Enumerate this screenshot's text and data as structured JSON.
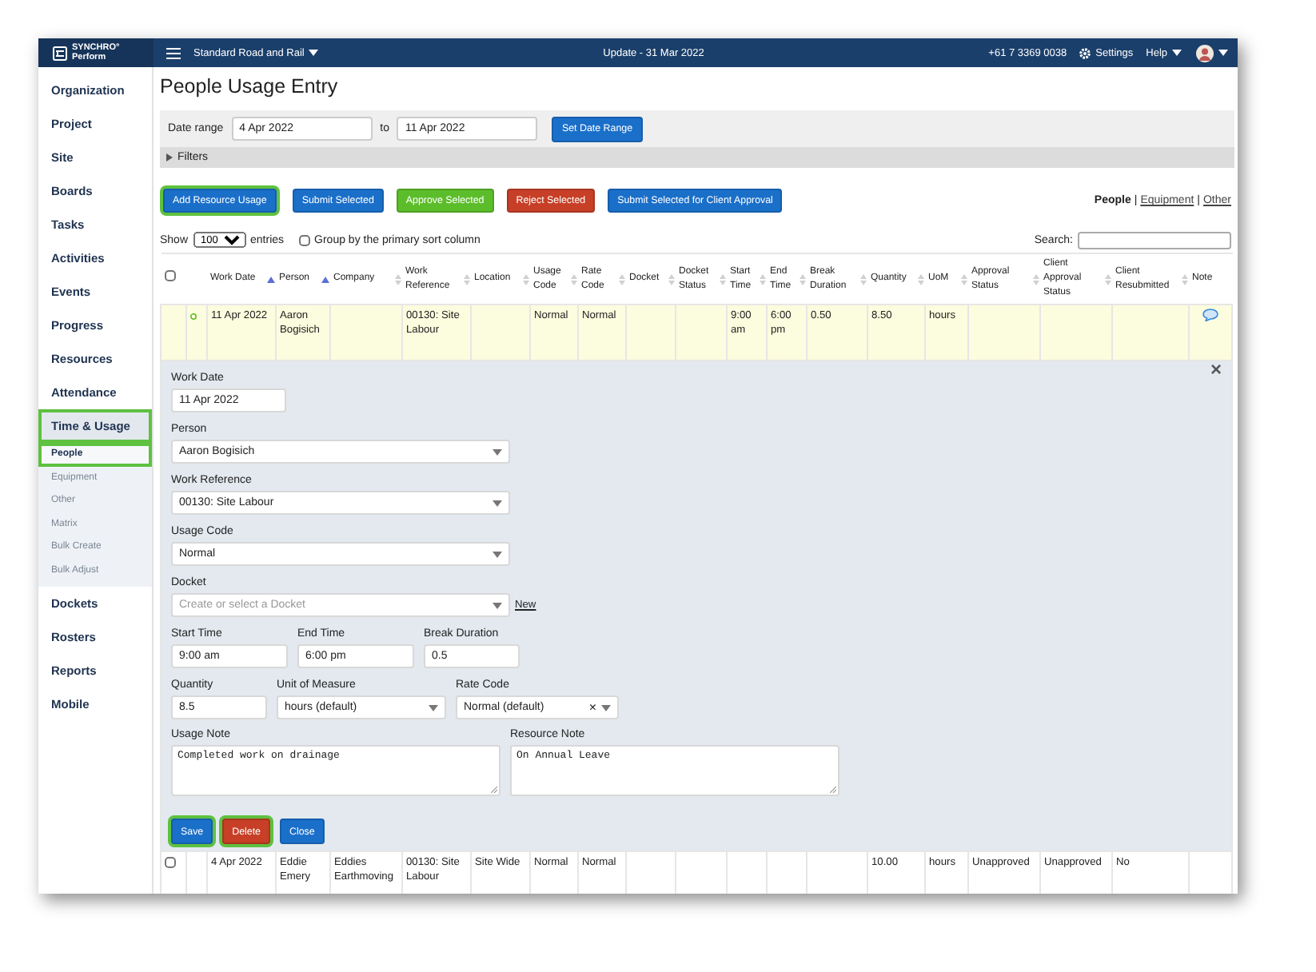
{
  "topbar": {
    "logo_line1": "SYNCHRO",
    "logo_mark": "°",
    "logo_line2": "Perform",
    "project": "Standard Road and Rail",
    "update": "Update - 31 Mar 2022",
    "phone": "+61 7 3369 0038",
    "settings": "Settings",
    "help": "Help"
  },
  "sidebar": {
    "items": [
      {
        "label": "Organization",
        "selected": false,
        "highlighted": false
      },
      {
        "label": "Project",
        "selected": false,
        "highlighted": false
      },
      {
        "label": "Site",
        "selected": false,
        "highlighted": false
      },
      {
        "label": "Boards",
        "selected": false,
        "highlighted": false
      },
      {
        "label": "Tasks",
        "selected": false,
        "highlighted": false
      },
      {
        "label": "Activities",
        "selected": false,
        "highlighted": false
      },
      {
        "label": "Events",
        "selected": false,
        "highlighted": false
      },
      {
        "label": "Progress",
        "selected": false,
        "highlighted": false
      },
      {
        "label": "Resources",
        "selected": false,
        "highlighted": false
      },
      {
        "label": "Attendance",
        "selected": false,
        "highlighted": false
      },
      {
        "label": "Time & Usage",
        "selected": true,
        "highlighted": true,
        "children": [
          {
            "label": "People",
            "selected": true,
            "highlighted": true
          },
          {
            "label": "Equipment",
            "selected": false,
            "highlighted": false
          },
          {
            "label": "Other",
            "selected": false,
            "highlighted": false
          },
          {
            "label": "Matrix",
            "selected": false,
            "highlighted": false
          },
          {
            "label": "Bulk Create",
            "selected": false,
            "highlighted": false
          },
          {
            "label": "Bulk Adjust",
            "selected": false,
            "highlighted": false
          }
        ]
      },
      {
        "label": "Dockets",
        "selected": false,
        "highlighted": false
      },
      {
        "label": "Rosters",
        "selected": false,
        "highlighted": false
      },
      {
        "label": "Reports",
        "selected": false,
        "highlighted": false
      },
      {
        "label": "Mobile",
        "selected": false,
        "highlighted": false
      }
    ]
  },
  "page_title": "People Usage Entry",
  "date_range": {
    "label": "Date range",
    "from": "4 Apr 2022",
    "to_label": "to",
    "to": "11 Apr 2022",
    "button": "Set Date Range"
  },
  "filters": {
    "label": "Filters",
    "expanded": false
  },
  "actions": [
    {
      "label": "Add Resource Usage",
      "kind": "primary",
      "highlighted": true
    },
    {
      "label": "Submit Selected",
      "kind": "primary",
      "highlighted": false
    },
    {
      "label": "Approve Selected",
      "kind": "success",
      "highlighted": false
    },
    {
      "label": "Reject Selected",
      "kind": "danger",
      "highlighted": false
    },
    {
      "label": "Submit Selected for Client Approval",
      "kind": "primary",
      "highlighted": false
    }
  ],
  "view_links": {
    "separator": "|",
    "items": [
      {
        "label": "People",
        "selected": true
      },
      {
        "label": "Equipment",
        "selected": false
      },
      {
        "label": "Other",
        "selected": false
      }
    ]
  },
  "table_controls": {
    "show_label": "Show",
    "page_size": "100",
    "entries_label": "entries",
    "group_label": "Group by the primary sort column",
    "group_checked": false,
    "search_label": "Search:"
  },
  "table": {
    "select_all_checked": false,
    "columns": [
      {
        "label": "Work Date",
        "sorted": true
      },
      {
        "label": "Person",
        "sorted": true
      },
      {
        "label": "Company",
        "sorted": false
      },
      {
        "label": "Work Reference",
        "sorted": false
      },
      {
        "label": "Location",
        "sorted": false
      },
      {
        "label": "Usage Code",
        "sorted": false
      },
      {
        "label": "Rate Code",
        "sorted": false
      },
      {
        "label": "Docket",
        "sorted": false
      },
      {
        "label": "Docket Status",
        "sorted": false
      },
      {
        "label": "Start Time",
        "sorted": false
      },
      {
        "label": "End Time",
        "sorted": false
      },
      {
        "label": "Break Duration",
        "sorted": false
      },
      {
        "label": "Quantity",
        "sorted": false
      },
      {
        "label": "UoM",
        "sorted": false
      },
      {
        "label": "Approval Status",
        "sorted": false
      },
      {
        "label": "Client Approval Status",
        "sorted": false
      },
      {
        "label": "Client Resubmitted",
        "sorted": false
      },
      {
        "label": "Note"
      }
    ],
    "rows": [
      {
        "editing": true,
        "selectable": false,
        "marker": true,
        "has_note": true,
        "cells": [
          "11 Apr 2022",
          "Aaron Bogisich",
          null,
          "00130: Site Labour",
          null,
          "Normal",
          "Normal",
          null,
          null,
          "9:00 am",
          "6:00 pm",
          "0.50",
          "8.50",
          "hours",
          null,
          null,
          null
        ],
        "form": {
          "work_date": {
            "label": "Work Date",
            "value": "11 Apr 2022"
          },
          "person": {
            "label": "Person",
            "value": "Aaron Bogisich"
          },
          "work_reference": {
            "label": "Work Reference",
            "value": "00130: Site Labour"
          },
          "usage_code": {
            "label": "Usage Code",
            "value": "Normal"
          },
          "docket": {
            "label": "Docket",
            "placeholder": "Create or select a Docket",
            "link": "New"
          },
          "start_time": {
            "label": "Start Time",
            "value": "9:00 am"
          },
          "end_time": {
            "label": "End Time",
            "value": "6:00 pm"
          },
          "break_duration": {
            "label": "Break Duration",
            "value": "0.5"
          },
          "quantity": {
            "label": "Quantity",
            "value": "8.5"
          },
          "unit_of_measure": {
            "label": "Unit of Measure",
            "value": "hours (default)"
          },
          "rate_code": {
            "label": "Rate Code",
            "value": "Normal (default)",
            "clear": "×"
          },
          "usage_note": {
            "label": "Usage Note",
            "value": "Completed work on drainage"
          },
          "resource_note": {
            "label": "Resource Note",
            "value": "On Annual Leave"
          },
          "close_icon": "×",
          "buttons": [
            {
              "label": "Save",
              "kind": "primary",
              "highlighted": true
            },
            {
              "label": "Delete",
              "kind": "danger",
              "highlighted": true
            },
            {
              "label": "Close",
              "kind": "primary",
              "highlighted": false
            }
          ]
        }
      },
      {
        "editing": false,
        "selectable": true,
        "checked": false,
        "marker": false,
        "has_note": false,
        "cells": [
          "4 Apr 2022",
          "Eddie Emery",
          "Eddies Earthmoving",
          "00130: Site Labour",
          "Site Wide",
          "Normal",
          "Normal",
          null,
          null,
          null,
          null,
          null,
          "10.00",
          "hours",
          "Unapproved",
          "Unapproved",
          "No"
        ]
      }
    ]
  }
}
